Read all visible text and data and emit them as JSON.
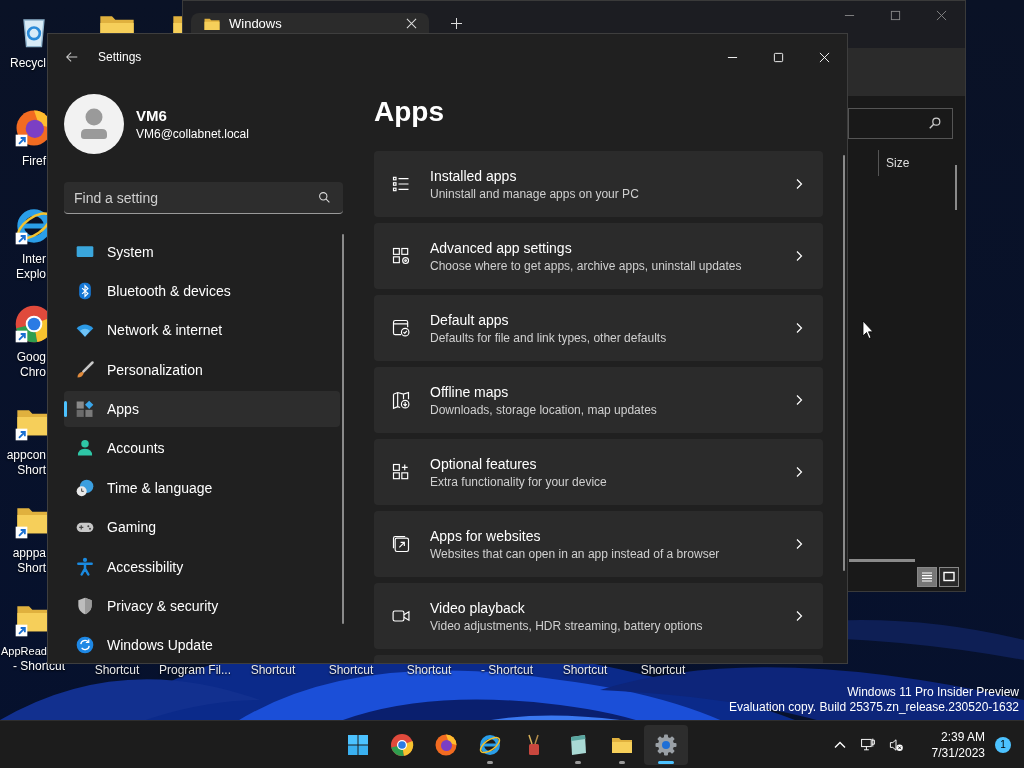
{
  "desktop": {
    "icons": [
      {
        "kind": "recycle-bin",
        "shortcut": false,
        "label": [
          "Recycl"
        ]
      },
      {
        "kind": "firefox",
        "shortcut": true,
        "label": [
          "Firef"
        ]
      },
      {
        "kind": "ie",
        "shortcut": true,
        "label": [
          "Inter",
          "Explo"
        ]
      },
      {
        "kind": "chrome",
        "shortcut": true,
        "label": [
          "Goog",
          "Chro"
        ]
      },
      {
        "kind": "folder",
        "shortcut": true,
        "label": [
          "appcon",
          "Short"
        ]
      },
      {
        "kind": "folder",
        "shortcut": true,
        "label": [
          "apppa",
          "Short"
        ]
      },
      {
        "kind": "folder",
        "shortcut": true,
        "label": [
          "AppRead",
          "- Shortcut"
        ]
      }
    ],
    "hidden_icon_labels": [
      "Shortcut",
      "Program Fil...",
      "Shortcut",
      "Shortcut",
      "Shortcut",
      "- Shortcut",
      "Shortcut",
      "Shortcut"
    ],
    "build_info": [
      "Windows 11 Pro Insider Preview",
      "Evaluation copy. Build 25375.zn_release.230520-1632"
    ]
  },
  "explorer": {
    "tab": "Windows",
    "columns": [
      "Size"
    ],
    "views": [
      {
        "kind": "details",
        "selected": true
      },
      {
        "kind": "tiles",
        "selected": false
      }
    ]
  },
  "settings": {
    "title": "Settings",
    "user": {
      "name": "VM6",
      "email": "VM6@collabnet.local"
    },
    "search": {
      "placeholder": "Find a setting"
    },
    "nav": [
      {
        "kind": "system",
        "label": "System",
        "selected": false
      },
      {
        "kind": "bluetooth",
        "label": "Bluetooth & devices",
        "selected": false
      },
      {
        "kind": "network",
        "label": "Network & internet",
        "selected": false
      },
      {
        "kind": "personalization",
        "label": "Personalization",
        "selected": false
      },
      {
        "kind": "apps",
        "label": "Apps",
        "selected": true
      },
      {
        "kind": "accounts",
        "label": "Accounts",
        "selected": false
      },
      {
        "kind": "time",
        "label": "Time & language",
        "selected": false
      },
      {
        "kind": "gaming",
        "label": "Gaming",
        "selected": false
      },
      {
        "kind": "accessibility",
        "label": "Accessibility",
        "selected": false
      },
      {
        "kind": "privacy",
        "label": "Privacy & security",
        "selected": false
      },
      {
        "kind": "update",
        "label": "Windows Update",
        "selected": false
      }
    ],
    "page_title": "Apps",
    "cards": [
      {
        "kind": "installed",
        "title": "Installed apps",
        "subtitle": "Uninstall and manage apps on your PC"
      },
      {
        "kind": "advanced",
        "title": "Advanced app settings",
        "subtitle": "Choose where to get apps, archive apps, uninstall updates"
      },
      {
        "kind": "default",
        "title": "Default apps",
        "subtitle": "Defaults for file and link types, other defaults"
      },
      {
        "kind": "maps",
        "title": "Offline maps",
        "subtitle": "Downloads, storage location, map updates"
      },
      {
        "kind": "optional",
        "title": "Optional features",
        "subtitle": "Extra functionality for your device"
      },
      {
        "kind": "websites",
        "title": "Apps for websites",
        "subtitle": "Websites that can open in an app instead of a browser"
      },
      {
        "kind": "video",
        "title": "Video playback",
        "subtitle": "Video adjustments, HDR streaming, battery options"
      }
    ]
  },
  "taskbar": {
    "apps": [
      {
        "kind": "start",
        "running": false,
        "selected": false
      },
      {
        "kind": "chrome",
        "running": false,
        "selected": false
      },
      {
        "kind": "firefox",
        "running": false,
        "selected": false
      },
      {
        "kind": "ie",
        "running": true,
        "selected": false
      },
      {
        "kind": "paint",
        "running": false,
        "selected": false
      },
      {
        "kind": "notepad",
        "running": true,
        "selected": false
      },
      {
        "kind": "folder",
        "running": true,
        "selected": false
      },
      {
        "kind": "settings",
        "running": true,
        "selected": true
      }
    ],
    "tray": {
      "time": "2:39 AM",
      "date": "7/31/2023",
      "notifications": "1"
    }
  }
}
